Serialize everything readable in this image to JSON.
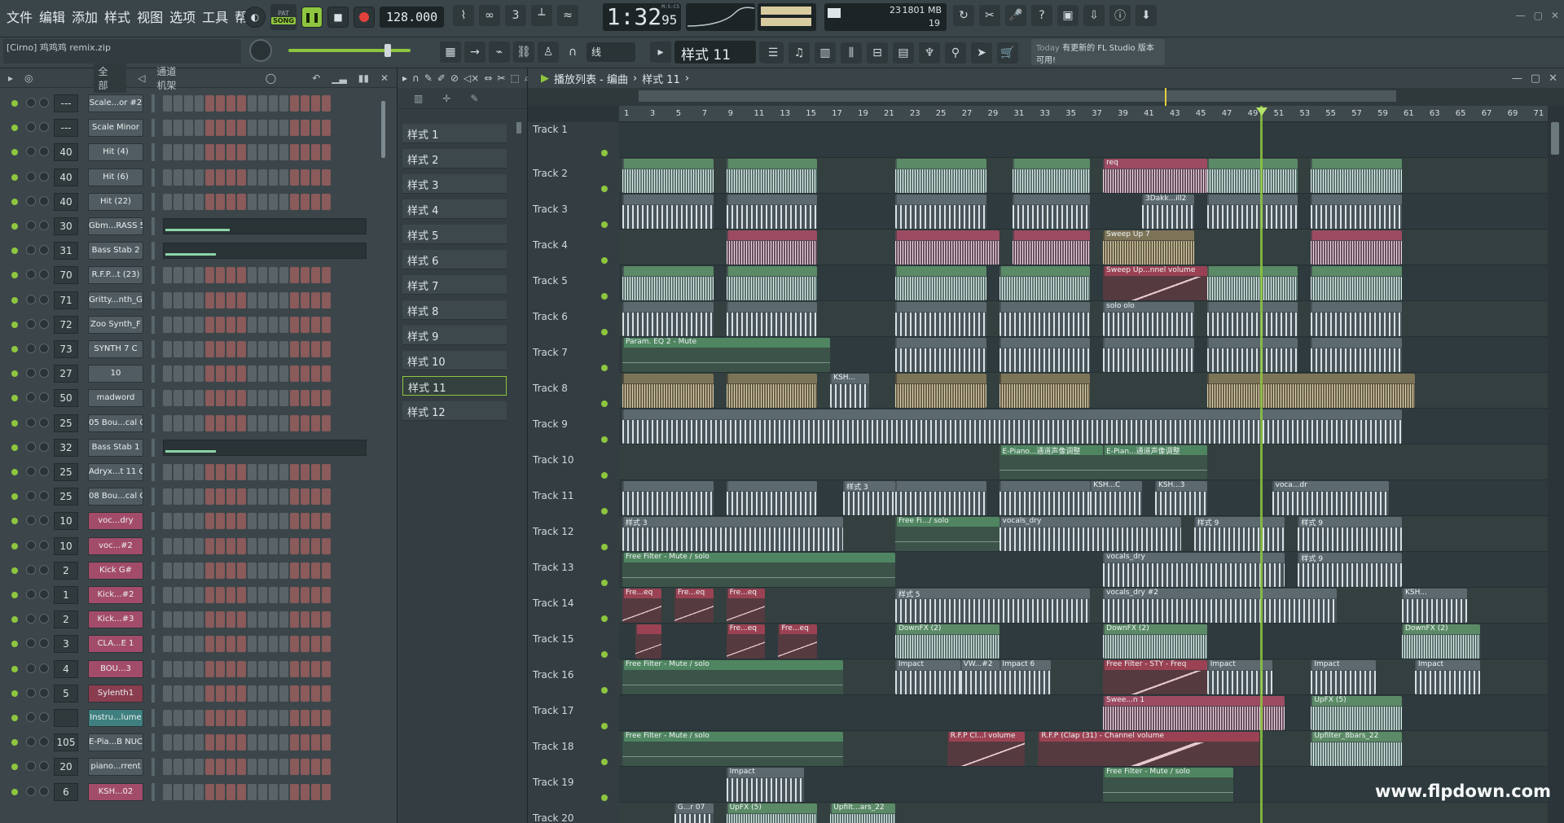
{
  "menu": [
    "文件",
    "编辑",
    "添加",
    "样式",
    "视图",
    "选项",
    "工具",
    "帮助"
  ],
  "transport": {
    "pat_label": "PAT",
    "song_label": "SONG",
    "tempo": "128.000",
    "time": "1:32",
    "time_sub": "95",
    "time_unit": "M:S:CS"
  },
  "cpu": {
    "count": "23",
    "memory": "1801 MB",
    "polyphony": "19"
  },
  "project_file": "[Cirno] 鸡鸡鸡 remix.zip",
  "snap": "线",
  "current_pattern": "样式 11",
  "news": {
    "today": "Today",
    "text": "有更新的 FL Studio 版本可用!"
  },
  "rack": {
    "filter": "全部",
    "title": "通道机架"
  },
  "channels": [
    {
      "mix": "---",
      "name": "Scale...or #2",
      "color": "default",
      "type": "steps"
    },
    {
      "mix": "---",
      "name": "Scale Minor",
      "color": "default",
      "type": "steps"
    },
    {
      "mix": "40",
      "name": "Hit (4)",
      "color": "default",
      "type": "steps"
    },
    {
      "mix": "40",
      "name": "Hit (6)",
      "color": "default",
      "type": "steps"
    },
    {
      "mix": "40",
      "name": "Hit (22)",
      "color": "default",
      "type": "steps"
    },
    {
      "mix": "30",
      "name": "Gbm...RASS 5",
      "color": "default",
      "type": "graph",
      "fill": 0.32
    },
    {
      "mix": "31",
      "name": "Bass Stab 2",
      "color": "default",
      "type": "graph",
      "fill": 0.25
    },
    {
      "mix": "70",
      "name": "R.F.P...t (23)",
      "color": "default",
      "type": "steps"
    },
    {
      "mix": "71",
      "name": "Gritty...nth_G",
      "color": "default",
      "type": "steps"
    },
    {
      "mix": "72",
      "name": "Zoo Synth_F",
      "color": "default",
      "type": "steps"
    },
    {
      "mix": "73",
      "name": "SYNTH 7 C",
      "color": "default",
      "type": "steps"
    },
    {
      "mix": "27",
      "name": "10",
      "color": "default",
      "type": "steps"
    },
    {
      "mix": "50",
      "name": "madword",
      "color": "default",
      "type": "steps"
    },
    {
      "mix": "25",
      "name": "05 Bou...cal C",
      "color": "default",
      "type": "steps"
    },
    {
      "mix": "32",
      "name": "Bass Stab 1",
      "color": "default",
      "type": "graph",
      "fill": 0.25
    },
    {
      "mix": "25",
      "name": "Adryx...t 11 C",
      "color": "default",
      "type": "steps"
    },
    {
      "mix": "25",
      "name": "08 Bou...cal C",
      "color": "default",
      "type": "steps"
    },
    {
      "mix": "10",
      "name": "voc...dry",
      "color": "pink",
      "type": "steps"
    },
    {
      "mix": "10",
      "name": "voc...#2",
      "color": "pink",
      "type": "steps"
    },
    {
      "mix": "2",
      "name": "Kick G#",
      "color": "pink",
      "type": "steps"
    },
    {
      "mix": "1",
      "name": "Kick...#2",
      "color": "pink",
      "type": "steps"
    },
    {
      "mix": "2",
      "name": "Kick...#3",
      "color": "pink",
      "type": "steps"
    },
    {
      "mix": "3",
      "name": "CLA...E 1",
      "color": "pink",
      "type": "steps"
    },
    {
      "mix": "4",
      "name": "BOU...3",
      "color": "pink",
      "type": "steps"
    },
    {
      "mix": "5",
      "name": "Sylenth1",
      "color": "red",
      "type": "steps"
    },
    {
      "mix": "",
      "name": "Instru...lume",
      "color": "teal",
      "type": "steps"
    },
    {
      "mix": "105",
      "name": "E-Pia...B NUC",
      "color": "default",
      "type": "steps"
    },
    {
      "mix": "20",
      "name": "piano...rrent",
      "color": "default",
      "type": "steps"
    },
    {
      "mix": "6",
      "name": "KSH...02",
      "color": "pink",
      "type": "steps"
    }
  ],
  "patterns": [
    "样式 1",
    "样式 2",
    "样式 3",
    "样式 4",
    "样式 5",
    "样式 6",
    "样式 7",
    "样式 8",
    "样式 9",
    "样式 10",
    "样式 11",
    "样式 12"
  ],
  "selected_pattern_index": 10,
  "playlist": {
    "title": "播放列表 - 编曲",
    "pattern": "样式 11"
  },
  "bar_numbers": [
    "1",
    "3",
    "5",
    "7",
    "9",
    "11",
    "13",
    "15",
    "17",
    "19",
    "21",
    "23",
    "25",
    "27",
    "29",
    "31",
    "33",
    "35",
    "37",
    "39",
    "41",
    "43",
    "45",
    "47",
    "49",
    "51",
    "53",
    "55",
    "57",
    "59",
    "61",
    "63",
    "65",
    "67",
    "69",
    "71"
  ],
  "tracks": [
    "Track 1",
    "Track 2",
    "Track 3",
    "Track 4",
    "Track 5",
    "Track 6",
    "Track 7",
    "Track 8",
    "Track 9",
    "Track 10",
    "Track 11",
    "Track 12",
    "Track 13",
    "Track 14",
    "Track 15",
    "Track 16",
    "Track 17",
    "Track 18",
    "Track 19",
    "Track 20"
  ],
  "clips": [
    {
      "track": 1,
      "start": 1,
      "len": 7,
      "label": "",
      "kind": "green"
    },
    {
      "track": 1,
      "start": 9,
      "len": 7,
      "label": "",
      "kind": "green"
    },
    {
      "track": 1,
      "start": 22,
      "len": 7,
      "label": "",
      "kind": "green"
    },
    {
      "track": 1,
      "start": 31,
      "len": 6,
      "label": "",
      "kind": "green"
    },
    {
      "track": 1,
      "start": 38,
      "len": 8,
      "label": "req",
      "kind": "pink"
    },
    {
      "track": 1,
      "start": 46,
      "len": 7,
      "label": "",
      "kind": "green"
    },
    {
      "track": 1,
      "start": 54,
      "len": 7,
      "label": "",
      "kind": "green"
    },
    {
      "track": 2,
      "start": 1,
      "len": 7,
      "label": "",
      "kind": "gray"
    },
    {
      "track": 2,
      "start": 9,
      "len": 7,
      "label": "",
      "kind": "gray"
    },
    {
      "track": 2,
      "start": 22,
      "len": 7,
      "label": "",
      "kind": "gray"
    },
    {
      "track": 2,
      "start": 31,
      "len": 6,
      "label": "",
      "kind": "gray"
    },
    {
      "track": 2,
      "start": 41,
      "len": 4,
      "label": "3Dakk...ill2",
      "kind": "gray"
    },
    {
      "track": 2,
      "start": 46,
      "len": 7,
      "label": "",
      "kind": "gray"
    },
    {
      "track": 2,
      "start": 54,
      "len": 7,
      "label": "",
      "kind": "gray"
    },
    {
      "track": 3,
      "start": 9,
      "len": 7,
      "label": "",
      "kind": "pink"
    },
    {
      "track": 3,
      "start": 22,
      "len": 8,
      "label": "",
      "kind": "pink"
    },
    {
      "track": 3,
      "start": 31,
      "len": 6,
      "label": "",
      "kind": "pink"
    },
    {
      "track": 3,
      "start": 38,
      "len": 7,
      "label": "Sweep Up 7",
      "kind": "tan"
    },
    {
      "track": 3,
      "start": 54,
      "len": 7,
      "label": "",
      "kind": "pink"
    },
    {
      "track": 4,
      "start": 1,
      "len": 7,
      "label": "",
      "kind": "green"
    },
    {
      "track": 4,
      "start": 9,
      "len": 7,
      "label": "",
      "kind": "green"
    },
    {
      "track": 4,
      "start": 22,
      "len": 7,
      "label": "",
      "kind": "green"
    },
    {
      "track": 4,
      "start": 30,
      "len": 7,
      "label": "",
      "kind": "green"
    },
    {
      "track": 4,
      "start": 38,
      "len": 8,
      "label": "Sweep Up...nnel volume",
      "kind": "redauto"
    },
    {
      "track": 4,
      "start": 46,
      "len": 7,
      "label": "",
      "kind": "green"
    },
    {
      "track": 4,
      "start": 54,
      "len": 7,
      "label": "",
      "kind": "green"
    },
    {
      "track": 5,
      "start": 1,
      "len": 7,
      "label": "",
      "kind": "gray"
    },
    {
      "track": 5,
      "start": 9,
      "len": 7,
      "label": "",
      "kind": "gray"
    },
    {
      "track": 5,
      "start": 22,
      "len": 7,
      "label": "",
      "kind": "gray"
    },
    {
      "track": 5,
      "start": 30,
      "len": 7,
      "label": "",
      "kind": "gray"
    },
    {
      "track": 5,
      "start": 38,
      "len": 7,
      "label": "solo olo",
      "kind": "gray"
    },
    {
      "track": 5,
      "start": 46,
      "len": 7,
      "label": "",
      "kind": "gray"
    },
    {
      "track": 5,
      "start": 54,
      "len": 7,
      "label": "",
      "kind": "gray"
    },
    {
      "track": 6,
      "start": 1,
      "len": 16,
      "label": "Param. EQ 2 - Mute",
      "kind": "auto"
    },
    {
      "track": 6,
      "start": 22,
      "len": 7,
      "label": "",
      "kind": "gray"
    },
    {
      "track": 6,
      "start": 30,
      "len": 7,
      "label": "",
      "kind": "gray"
    },
    {
      "track": 6,
      "start": 38,
      "len": 7,
      "label": "",
      "kind": "gray"
    },
    {
      "track": 6,
      "start": 46,
      "len": 7,
      "label": "",
      "kind": "gray"
    },
    {
      "track": 6,
      "start": 54,
      "len": 7,
      "label": "",
      "kind": "gray"
    },
    {
      "track": 7,
      "start": 1,
      "len": 7,
      "label": "",
      "kind": "tan"
    },
    {
      "track": 7,
      "start": 9,
      "len": 7,
      "label": "",
      "kind": "tan"
    },
    {
      "track": 7,
      "start": 17,
      "len": 3,
      "label": "KSH...",
      "kind": "gray"
    },
    {
      "track": 7,
      "start": 22,
      "len": 7,
      "label": "",
      "kind": "tan"
    },
    {
      "track": 7,
      "start": 30,
      "len": 7,
      "label": "",
      "kind": "tan"
    },
    {
      "track": 7,
      "start": 46,
      "len": 16,
      "label": "",
      "kind": "tan"
    },
    {
      "track": 8,
      "start": 1,
      "len": 60,
      "label": "",
      "kind": "gray"
    },
    {
      "track": 9,
      "start": 30,
      "len": 8,
      "label": "E-Piano...通道声像调整",
      "kind": "auto"
    },
    {
      "track": 9,
      "start": 38,
      "len": 8,
      "label": "E-Pian...通道声像调整",
      "kind": "auto"
    },
    {
      "track": 10,
      "start": 1,
      "len": 7,
      "label": "",
      "kind": "gray"
    },
    {
      "track": 10,
      "start": 9,
      "len": 7,
      "label": "",
      "kind": "gray"
    },
    {
      "track": 10,
      "start": 18,
      "len": 4,
      "label": "样式 3",
      "kind": "gray"
    },
    {
      "track": 10,
      "start": 22,
      "len": 7,
      "label": "",
      "kind": "gray"
    },
    {
      "track": 10,
      "start": 30,
      "len": 7,
      "label": "",
      "kind": "gray"
    },
    {
      "track": 10,
      "start": 37,
      "len": 4,
      "label": "KSH...C",
      "kind": "gray"
    },
    {
      "track": 10,
      "start": 42,
      "len": 4,
      "label": "KSH...3",
      "kind": "gray"
    },
    {
      "track": 10,
      "start": 51,
      "len": 9,
      "label": "voca...dr",
      "kind": "gray"
    },
    {
      "track": 11,
      "start": 1,
      "len": 17,
      "label": "样式 3",
      "kind": "gray"
    },
    {
      "track": 11,
      "start": 22,
      "len": 8,
      "label": "Free Fi.../ solo",
      "kind": "auto"
    },
    {
      "track": 11,
      "start": 30,
      "len": 14,
      "label": "vocals_dry",
      "kind": "gray"
    },
    {
      "track": 11,
      "start": 45,
      "len": 7,
      "label": "样式 9",
      "kind": "gray"
    },
    {
      "track": 11,
      "start": 53,
      "len": 8,
      "label": "样式 9",
      "kind": "gray"
    },
    {
      "track": 12,
      "start": 1,
      "len": 21,
      "label": "Free Filter - Mute / solo",
      "kind": "auto"
    },
    {
      "track": 12,
      "start": 38,
      "len": 14,
      "label": "vocals_dry",
      "kind": "gray"
    },
    {
      "track": 12,
      "start": 53,
      "len": 8,
      "label": "样式 9",
      "kind": "gray"
    },
    {
      "track": 13,
      "start": 1,
      "len": 3,
      "label": "Fre...eq",
      "kind": "redauto"
    },
    {
      "track": 13,
      "start": 5,
      "len": 3,
      "label": "Fre...eq",
      "kind": "redauto"
    },
    {
      "track": 13,
      "start": 9,
      "len": 3,
      "label": "Fre...eq",
      "kind": "redauto"
    },
    {
      "track": 13,
      "start": 22,
      "len": 15,
      "label": "样式 5",
      "kind": "gray"
    },
    {
      "track": 13,
      "start": 38,
      "len": 18,
      "label": "vocals_dry #2",
      "kind": "gray"
    },
    {
      "track": 13,
      "start": 61,
      "len": 5,
      "label": "KSH...",
      "kind": "gray"
    },
    {
      "track": 14,
      "start": 2,
      "len": 2,
      "label": "",
      "kind": "redauto"
    },
    {
      "track": 14,
      "start": 9,
      "len": 3,
      "label": "Fre...eq",
      "kind": "redauto"
    },
    {
      "track": 14,
      "start": 13,
      "len": 3,
      "label": "Fre...eq",
      "kind": "redauto"
    },
    {
      "track": 14,
      "start": 22,
      "len": 8,
      "label": "DownFX (2)",
      "kind": "green"
    },
    {
      "track": 14,
      "start": 38,
      "len": 8,
      "label": "DownFX (2)",
      "kind": "green"
    },
    {
      "track": 14,
      "start": 61,
      "len": 6,
      "label": "DownFX (2)",
      "kind": "green"
    },
    {
      "track": 15,
      "start": 1,
      "len": 17,
      "label": "Free Filter - Mute / solo",
      "kind": "auto"
    },
    {
      "track": 15,
      "start": 22,
      "len": 5,
      "label": "Impact",
      "kind": "gray"
    },
    {
      "track": 15,
      "start": 27,
      "len": 3,
      "label": "VW...#2",
      "kind": "gray"
    },
    {
      "track": 15,
      "start": 30,
      "len": 4,
      "label": "Impact 6",
      "kind": "gray"
    },
    {
      "track": 15,
      "start": 38,
      "len": 8,
      "label": "Free Filter - STY - Freq",
      "kind": "redauto"
    },
    {
      "track": 15,
      "start": 46,
      "len": 5,
      "label": "Impact",
      "kind": "gray"
    },
    {
      "track": 15,
      "start": 54,
      "len": 5,
      "label": "Impact",
      "kind": "gray"
    },
    {
      "track": 15,
      "start": 62,
      "len": 5,
      "label": "Impact",
      "kind": "gray"
    },
    {
      "track": 16,
      "start": 38,
      "len": 14,
      "label": "Swee...n 1",
      "kind": "pink"
    },
    {
      "track": 16,
      "start": 54,
      "len": 7,
      "label": "UpFX (5)",
      "kind": "green"
    },
    {
      "track": 17,
      "start": 1,
      "len": 17,
      "label": "Free Filter - Mute / solo",
      "kind": "auto"
    },
    {
      "track": 17,
      "start": 26,
      "len": 6,
      "label": "R.F.P Cl...l volume",
      "kind": "redauto"
    },
    {
      "track": 17,
      "start": 33,
      "len": 17,
      "label": "R.F.P (Clap (31) - Channel volume",
      "kind": "redauto"
    },
    {
      "track": 17,
      "start": 54,
      "len": 7,
      "label": "Upfilter_8bars_22",
      "kind": "green"
    },
    {
      "track": 18,
      "start": 9,
      "len": 6,
      "label": "Impact",
      "kind": "gray"
    },
    {
      "track": 18,
      "start": 38,
      "len": 10,
      "label": "Free Filter - Mute / solo",
      "kind": "auto"
    },
    {
      "track": 19,
      "start": 5,
      "len": 3,
      "label": "G...r 07",
      "kind": "gray"
    },
    {
      "track": 19,
      "start": 9,
      "len": 7,
      "label": "UpFX (5)",
      "kind": "green"
    },
    {
      "track": 19,
      "start": 17,
      "len": 5,
      "label": "Upfilt...ars_22",
      "kind": "green"
    }
  ],
  "watermark": "www.flpdown.com"
}
